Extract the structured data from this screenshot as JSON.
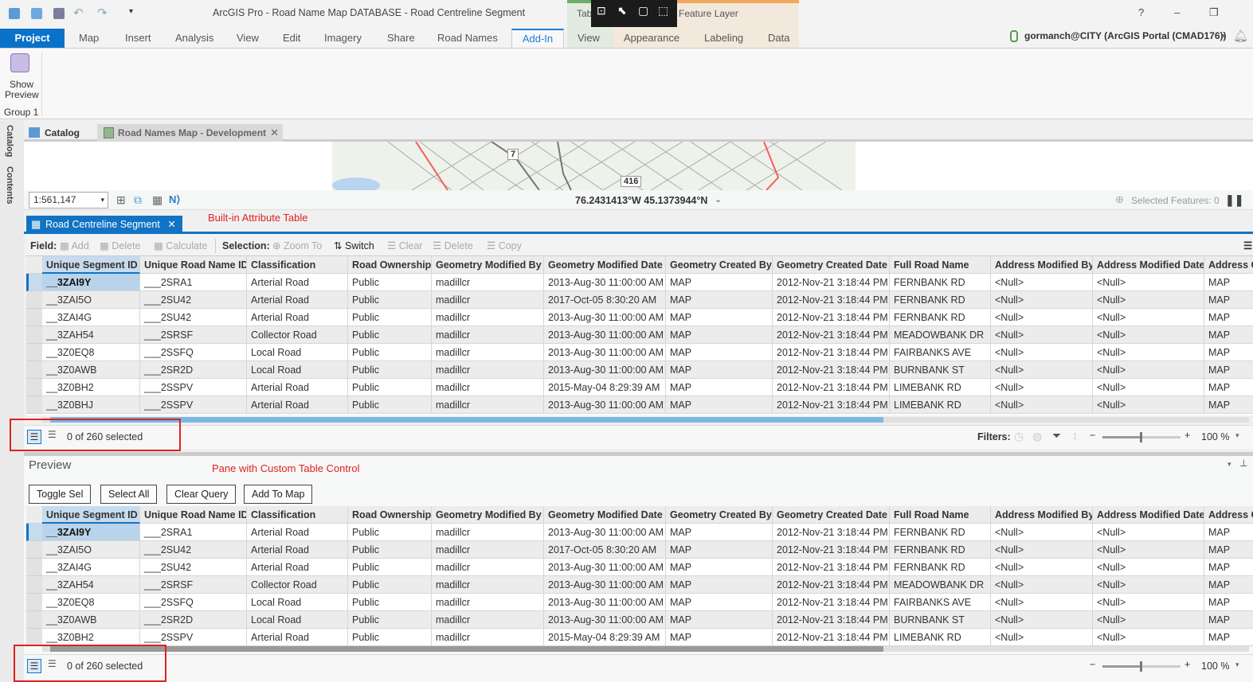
{
  "window": {
    "title": "ArcGIS Pro - Road Name Map DATABASE - Road Centreline Segment",
    "help": "?",
    "minimize": "–",
    "restore": "❐"
  },
  "contextual_tabs": {
    "table_group": "Tab",
    "feature_layer_group": "Feature Layer"
  },
  "ribbon_tabs": [
    {
      "label": "Project"
    },
    {
      "label": "Map"
    },
    {
      "label": "Insert"
    },
    {
      "label": "Analysis"
    },
    {
      "label": "View"
    },
    {
      "label": "Edit"
    },
    {
      "label": "Imagery"
    },
    {
      "label": "Share"
    },
    {
      "label": "Road Names"
    },
    {
      "label": "Add-In"
    },
    {
      "label": "View"
    },
    {
      "label": "Appearance"
    },
    {
      "label": "Labeling"
    },
    {
      "label": "Data"
    }
  ],
  "active_tab": "Add-In",
  "user": {
    "name": "gormanch@CITY (ArcGIS Portal (CMAD176))"
  },
  "ribbon": {
    "show_preview_line1": "Show",
    "show_preview_line2": "Preview",
    "group_label": "Group 1"
  },
  "side_panes": [
    "Catalog",
    "Contents"
  ],
  "doc_tabs": [
    {
      "label": "Catalog"
    },
    {
      "label": "Road Names Map - Development"
    }
  ],
  "map": {
    "shield_7": "7",
    "shield_416": "416",
    "scale": "1:561,147",
    "coordinates": "76.2431413°W 45.1373944°N",
    "selected_features": "Selected Features: 0"
  },
  "attribute_table": {
    "tab_label": "Road Centreline Segment",
    "annotation": "Built-in Attribute Table",
    "field_label": "Field:",
    "field_tools": [
      "Add",
      "Delete",
      "Calculate"
    ],
    "selection_label": "Selection:",
    "selection_tools": [
      "Zoom To",
      "Switch",
      "Clear",
      "Delete",
      "Copy"
    ],
    "columns": [
      "Unique Segment ID",
      "Unique Road Name ID",
      "Classification",
      "Road Ownership",
      "Geometry Modified By",
      "Geometry Modified Date",
      "Geometry Created By",
      "Geometry Created Date",
      "Full Road Name",
      "Address Modified By",
      "Address Modified Date",
      "Address C"
    ],
    "rows": [
      [
        "__3ZAI9Y",
        "___2SRA1",
        "Arterial Road",
        "Public",
        "madillcr",
        "2013-Aug-30 11:00:00 AM",
        "MAP",
        "2012-Nov-21 3:18:44 PM",
        "FERNBANK RD",
        "<Null>",
        "<Null>",
        "MAP"
      ],
      [
        "__3ZAI5O",
        "___2SU42",
        "Arterial Road",
        "Public",
        "madillcr",
        "2017-Oct-05 8:30:20 AM",
        "MAP",
        "2012-Nov-21 3:18:44 PM",
        "FERNBANK RD",
        "<Null>",
        "<Null>",
        "MAP"
      ],
      [
        "__3ZAI4G",
        "___2SU42",
        "Arterial Road",
        "Public",
        "madillcr",
        "2013-Aug-30 11:00:00 AM",
        "MAP",
        "2012-Nov-21 3:18:44 PM",
        "FERNBANK RD",
        "<Null>",
        "<Null>",
        "MAP"
      ],
      [
        "__3ZAH54",
        "___2SRSF",
        "Collector Road",
        "Public",
        "madillcr",
        "2013-Aug-30 11:00:00 AM",
        "MAP",
        "2012-Nov-21 3:18:44 PM",
        "MEADOWBANK DR",
        "<Null>",
        "<Null>",
        "MAP"
      ],
      [
        "__3Z0EQ8",
        "___2SSFQ",
        "Local Road",
        "Public",
        "madillcr",
        "2013-Aug-30 11:00:00 AM",
        "MAP",
        "2012-Nov-21 3:18:44 PM",
        "FAIRBANKS AVE",
        "<Null>",
        "<Null>",
        "MAP"
      ],
      [
        "__3Z0AWB",
        "___2SR2D",
        "Local Road",
        "Public",
        "madillcr",
        "2013-Aug-30 11:00:00 AM",
        "MAP",
        "2012-Nov-21 3:18:44 PM",
        "BURNBANK ST",
        "<Null>",
        "<Null>",
        "MAP"
      ],
      [
        "__3Z0BH2",
        "___2SSPV",
        "Arterial Road",
        "Public",
        "madillcr",
        "2015-May-04 8:29:39 AM",
        "MAP",
        "2012-Nov-21 3:18:44 PM",
        "LIMEBANK RD",
        "<Null>",
        "<Null>",
        "MAP"
      ],
      [
        "__3Z0BHJ",
        "___2SSPV",
        "Arterial Road",
        "Public",
        "madillcr",
        "2013-Aug-30 11:00:00 AM",
        "MAP",
        "2012-Nov-21 3:18:44 PM",
        "LIMEBANK RD",
        "<Null>",
        "<Null>",
        "MAP"
      ]
    ],
    "selection_status": "0 of 260 selected",
    "filters_label": "Filters:",
    "zoom_level": "100 %",
    "zoom_percent": 100
  },
  "preview": {
    "title": "Preview",
    "annotation": "Pane with Custom Table Control",
    "buttons": [
      "Toggle Sel",
      "Select All",
      "Clear Query",
      "Add To Map"
    ],
    "columns": [
      "Unique Segment ID",
      "Unique Road Name ID",
      "Classification",
      "Road Ownership",
      "Geometry Modified By",
      "Geometry Modified Date",
      "Geometry Created By",
      "Geometry Created Date",
      "Full Road Name",
      "Address Modified By",
      "Address Modified Date",
      "Address C"
    ],
    "rows": [
      [
        "__3ZAI9Y",
        "___2SRA1",
        "Arterial Road",
        "Public",
        "madillcr",
        "2013-Aug-30 11:00:00 AM",
        "MAP",
        "2012-Nov-21 3:18:44 PM",
        "FERNBANK RD",
        "<Null>",
        "<Null>",
        "MAP"
      ],
      [
        "__3ZAI5O",
        "___2SU42",
        "Arterial Road",
        "Public",
        "madillcr",
        "2017-Oct-05 8:30:20 AM",
        "MAP",
        "2012-Nov-21 3:18:44 PM",
        "FERNBANK RD",
        "<Null>",
        "<Null>",
        "MAP"
      ],
      [
        "__3ZAI4G",
        "___2SU42",
        "Arterial Road",
        "Public",
        "madillcr",
        "2013-Aug-30 11:00:00 AM",
        "MAP",
        "2012-Nov-21 3:18:44 PM",
        "FERNBANK RD",
        "<Null>",
        "<Null>",
        "MAP"
      ],
      [
        "__3ZAH54",
        "___2SRSF",
        "Collector Road",
        "Public",
        "madillcr",
        "2013-Aug-30 11:00:00 AM",
        "MAP",
        "2012-Nov-21 3:18:44 PM",
        "MEADOWBANK DR",
        "<Null>",
        "<Null>",
        "MAP"
      ],
      [
        "__3Z0EQ8",
        "___2SSFQ",
        "Local Road",
        "Public",
        "madillcr",
        "2013-Aug-30 11:00:00 AM",
        "MAP",
        "2012-Nov-21 3:18:44 PM",
        "FAIRBANKS AVE",
        "<Null>",
        "<Null>",
        "MAP"
      ],
      [
        "__3Z0AWB",
        "___2SR2D",
        "Local Road",
        "Public",
        "madillcr",
        "2013-Aug-30 11:00:00 AM",
        "MAP",
        "2012-Nov-21 3:18:44 PM",
        "BURNBANK ST",
        "<Null>",
        "<Null>",
        "MAP"
      ],
      [
        "__3Z0BH2",
        "___2SSPV",
        "Arterial Road",
        "Public",
        "madillcr",
        "2015-May-04 8:29:39 AM",
        "MAP",
        "2012-Nov-21 3:18:44 PM",
        "LIMEBANK RD",
        "<Null>",
        "<Null>",
        "MAP"
      ]
    ],
    "selection_status": "0 of 260 selected",
    "zoom_level": "100 %",
    "zoom_percent": 100
  },
  "colors": {
    "accent": "#1273c4",
    "annotation_red": "#e02020",
    "selected_row": "#b8d3ea"
  }
}
